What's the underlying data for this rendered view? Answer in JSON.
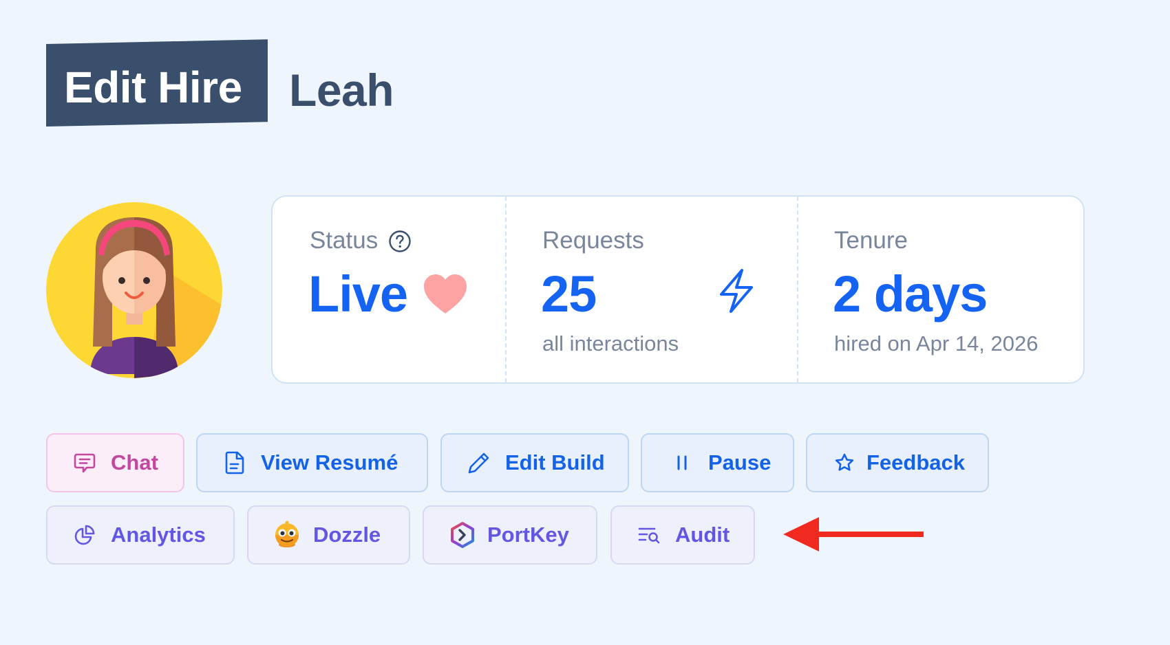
{
  "header": {
    "title": "Edit Hire",
    "name": "Leah"
  },
  "stats": {
    "status": {
      "label": "Status",
      "value": "Live"
    },
    "requests": {
      "label": "Requests",
      "value": "25",
      "sub": "all interactions"
    },
    "tenure": {
      "label": "Tenure",
      "value": "2 days",
      "sub": "hired on Apr 14, 2026"
    }
  },
  "actions": {
    "row1": [
      {
        "label": "Chat",
        "icon": "chat-icon"
      },
      {
        "label": "View Resumé",
        "icon": "document-icon"
      },
      {
        "label": "Edit Build",
        "icon": "pencil-icon"
      },
      {
        "label": "Pause",
        "icon": "pause-icon"
      },
      {
        "label": "Feedback",
        "icon": "star-icon"
      }
    ],
    "row2": [
      {
        "label": "Analytics",
        "icon": "pie-chart-icon"
      },
      {
        "label": "Dozzle",
        "icon": "dozzle-logo-icon"
      },
      {
        "label": "PortKey",
        "icon": "portkey-logo-icon"
      },
      {
        "label": "Audit",
        "icon": "audit-search-icon"
      }
    ]
  },
  "colors": {
    "background": "#eff5fd",
    "title_badge": "#394f6b",
    "accent_blue": "#1463f3",
    "chat_pink": "#c2479f",
    "purple": "#6256e2",
    "heart": "#fea3a3",
    "arrow": "#f02a1f"
  }
}
